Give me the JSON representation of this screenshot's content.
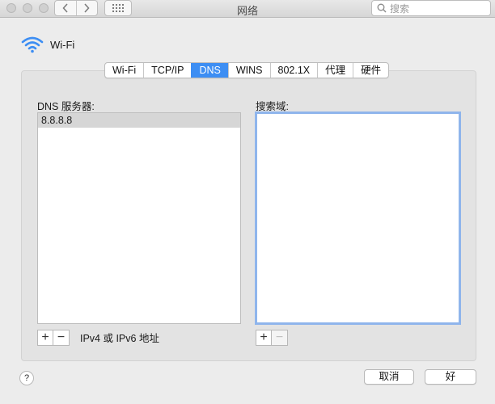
{
  "window": {
    "title": "网络"
  },
  "toolbar": {
    "back_icon": "chevron-left-icon",
    "forward_icon": "chevron-right-icon",
    "grid_icon": "grid-icon"
  },
  "search": {
    "placeholder": "搜索"
  },
  "header": {
    "title": "Wi-Fi",
    "icon": "wifi-icon"
  },
  "tabs": [
    {
      "label": "Wi-Fi",
      "active": false
    },
    {
      "label": "TCP/IP",
      "active": false
    },
    {
      "label": "DNS",
      "active": true
    },
    {
      "label": "WINS",
      "active": false
    },
    {
      "label": "802.1X",
      "active": false
    },
    {
      "label": "代理",
      "active": false
    },
    {
      "label": "硬件",
      "active": false
    }
  ],
  "dns": {
    "servers_label": "DNS 服务器:",
    "servers": [
      "8.8.8.8"
    ],
    "footer_note": "IPv4 或 IPv6 地址",
    "add_symbol": "+",
    "remove_symbol": "−"
  },
  "search_domains": {
    "label": "搜索域:",
    "add_symbol": "+",
    "remove_symbol": "−"
  },
  "footer": {
    "help_symbol": "?",
    "cancel_label": "取消",
    "ok_label": "好"
  },
  "colors": {
    "accent": "#3d8ef3",
    "focus_ring": "#8fb5ec"
  }
}
